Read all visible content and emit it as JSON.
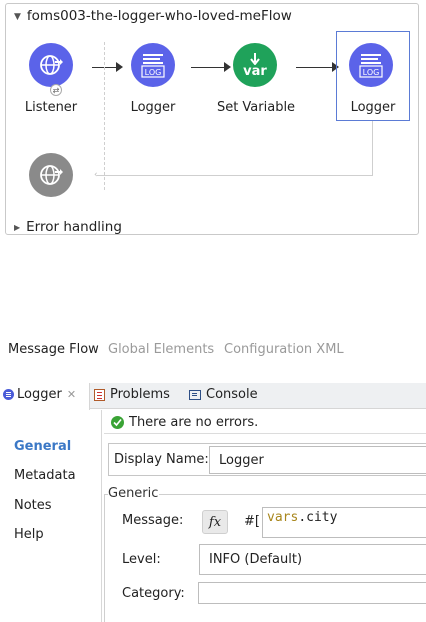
{
  "flow": {
    "title": "foms003-the-logger-who-loved-meFlow",
    "nodes": [
      {
        "label": "Listener",
        "icon": "globe-icon",
        "color": "#5b63e9"
      },
      {
        "label": "Logger",
        "icon": "log-icon",
        "color": "#5b63e9"
      },
      {
        "label": "Set Variable",
        "icon": "var-icon",
        "color": "#1fa25a",
        "sub": "var"
      },
      {
        "label": "Logger",
        "icon": "log-icon",
        "color": "#5b63e9"
      }
    ],
    "log_text": "LOG",
    "error_handling": "Error handling"
  },
  "view_tabs": [
    "Message Flow",
    "Global Elements",
    "Configuration XML"
  ],
  "editor_tabs": [
    {
      "label": "Logger",
      "icon": "logger-icon"
    },
    {
      "label": "Problems",
      "icon": "problems-icon"
    },
    {
      "label": "Console",
      "icon": "console-icon"
    }
  ],
  "status": {
    "text": "There are no errors."
  },
  "sidebar": {
    "items": [
      "General",
      "Metadata",
      "Notes",
      "Help"
    ]
  },
  "form": {
    "display_name_label": "Display Name:",
    "display_name_value": "Logger",
    "group_label": "Generic",
    "message_label": "Message:",
    "fx_label": "fx",
    "message_prefix": "#[",
    "message_var": "vars",
    "message_rest": ".city",
    "level_label": "Level:",
    "level_value": "INFO (Default)",
    "category_label": "Category:",
    "category_value": ""
  }
}
